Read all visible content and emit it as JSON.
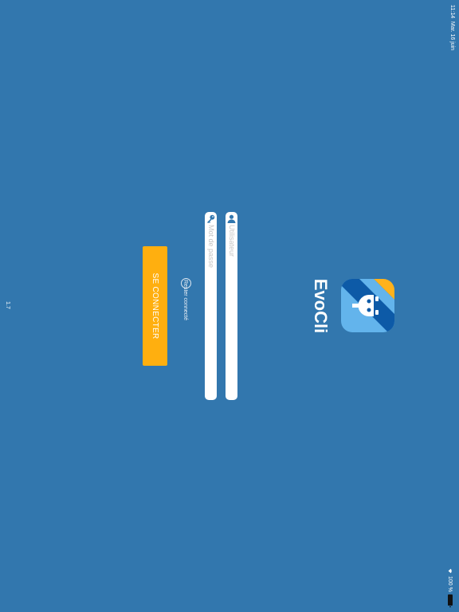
{
  "status_bar": {
    "time": "11:14",
    "date": "Mar. 16 juin",
    "battery": "100 %",
    "icons": [
      "wifi-icon",
      "battery-icon"
    ]
  },
  "app": {
    "name": "EvoCli",
    "logo_icon": "evocli-logo"
  },
  "login_form": {
    "username": {
      "value": "",
      "placeholder": "Utilisateur",
      "icon": "user-icon"
    },
    "password": {
      "value": "",
      "placeholder": "Mot de passe",
      "icon": "key-icon"
    },
    "remember_label": "Rester connecté",
    "remember_checked": false,
    "submit_label": "SE CONNECTER"
  },
  "version": "1.7",
  "colors": {
    "background": "#3277ae",
    "accent": "#ffaf0f",
    "field": "#ffffff",
    "logo_dark": "#0d5aa7",
    "logo_light": "#63b4ec",
    "logo_yellow": "#ffb21c"
  }
}
